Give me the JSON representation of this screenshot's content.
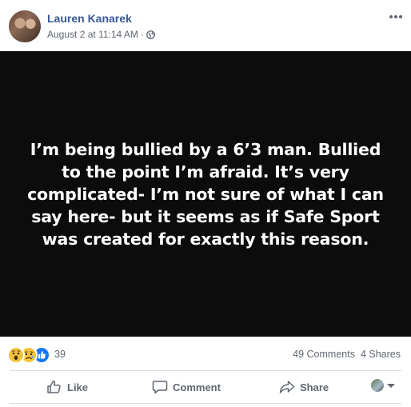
{
  "post": {
    "author": "Lauren Kanarek",
    "timestamp": "August 2 at 11:14 AM",
    "separator": "·",
    "audience_icon": "globe-icon",
    "menu_icon": "more-horizontal-icon",
    "image_text": "I’m being bullied by a 6’3 man. Bullied to the point I’m afraid. It’s very complicated- I’m not sure of what I can say here- but it seems as if Safe Sport was created for exactly this reason."
  },
  "reactions": {
    "types": [
      "wow",
      "sad",
      "like"
    ],
    "count": "39"
  },
  "stats": {
    "comments": "49 Comments",
    "shares": "4 Shares"
  },
  "actions": {
    "like_label": "Like",
    "comment_label": "Comment",
    "share_label": "Share"
  },
  "colors": {
    "author_link": "#385898",
    "secondary_text": "#606770",
    "image_background": "#0c0c0c",
    "like_blue": "#1877f2",
    "emoji_yellow": "#f5c33b"
  }
}
